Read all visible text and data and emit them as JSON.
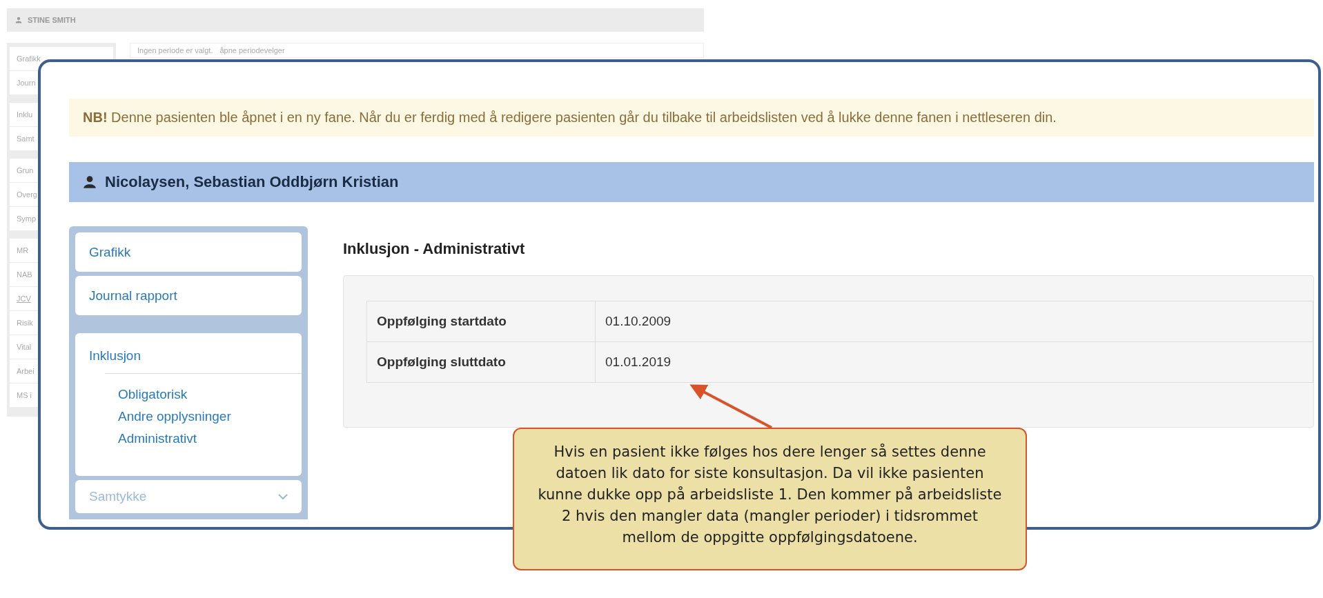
{
  "background_window": {
    "user": "STINE SMITH",
    "period_notice": "Ingen periode er valgt.",
    "period_link": "åpne periodevelger",
    "sidebar_groups": [
      {
        "items": [
          {
            "label": "Grafikk",
            "kind": "plain"
          },
          {
            "label": "Journ",
            "kind": "plain"
          }
        ]
      },
      {
        "items": [
          {
            "label": "Inklu",
            "kind": "plain"
          },
          {
            "label": "Samt",
            "kind": "plain"
          }
        ]
      },
      {
        "items": [
          {
            "label": "Grun",
            "kind": "plain"
          },
          {
            "label": "Overg",
            "kind": "plain"
          },
          {
            "label": "Symp",
            "kind": "plain"
          }
        ]
      },
      {
        "items": [
          {
            "label": "MR",
            "kind": "plain"
          },
          {
            "label": "NAB",
            "kind": "plain"
          },
          {
            "label": "JCV",
            "kind": "link"
          },
          {
            "label": "Risik",
            "kind": "plain"
          },
          {
            "label": "Vital",
            "kind": "plain"
          },
          {
            "label": "Arbei",
            "kind": "plain"
          },
          {
            "label": "MS i",
            "kind": "plain"
          }
        ]
      }
    ]
  },
  "patient_window": {
    "alert": "**NB!** Denne pasienten ble åpnet i en ny fane. Når du er ferdig med å redigere pasienten går du tilbake til arbeidslisten ved å lukke denne fanen i nettleseren din.",
    "patient_name": "Nicolaysen, Sebastian Oddbjørn Kristian",
    "sidebar": {
      "items": [
        {
          "label": "Grafikk",
          "kind": "link"
        },
        {
          "label": "Journal rapport",
          "kind": "link"
        },
        {
          "label": "Inklusjon",
          "kind": "group",
          "children": [
            {
              "label": "Obligatorisk"
            },
            {
              "label": "Andre opplysninger"
            },
            {
              "label": "Administrativt"
            }
          ]
        },
        {
          "label": "Samtykke",
          "kind": "collapsed"
        }
      ]
    },
    "section_title": "Inklusjon - Administrativt",
    "table": {
      "rows": [
        {
          "label": "Oppfølging startdato",
          "value": "01.10.2009"
        },
        {
          "label": "Oppfølging sluttdato",
          "value": "01.01.2019"
        }
      ]
    }
  },
  "callout": {
    "text": "Hvis en pasient ikke følges hos dere lenger så settes denne datoen lik dato for siste konsultasjon. Da vil ikke pasienten kunne dukke opp på arbeidsliste 1. Den kommer på arbeidsliste 2 hvis den mangler data (mangler perioder) i tidsrommet mellom de oppgitte oppfølgingsdatoene."
  }
}
